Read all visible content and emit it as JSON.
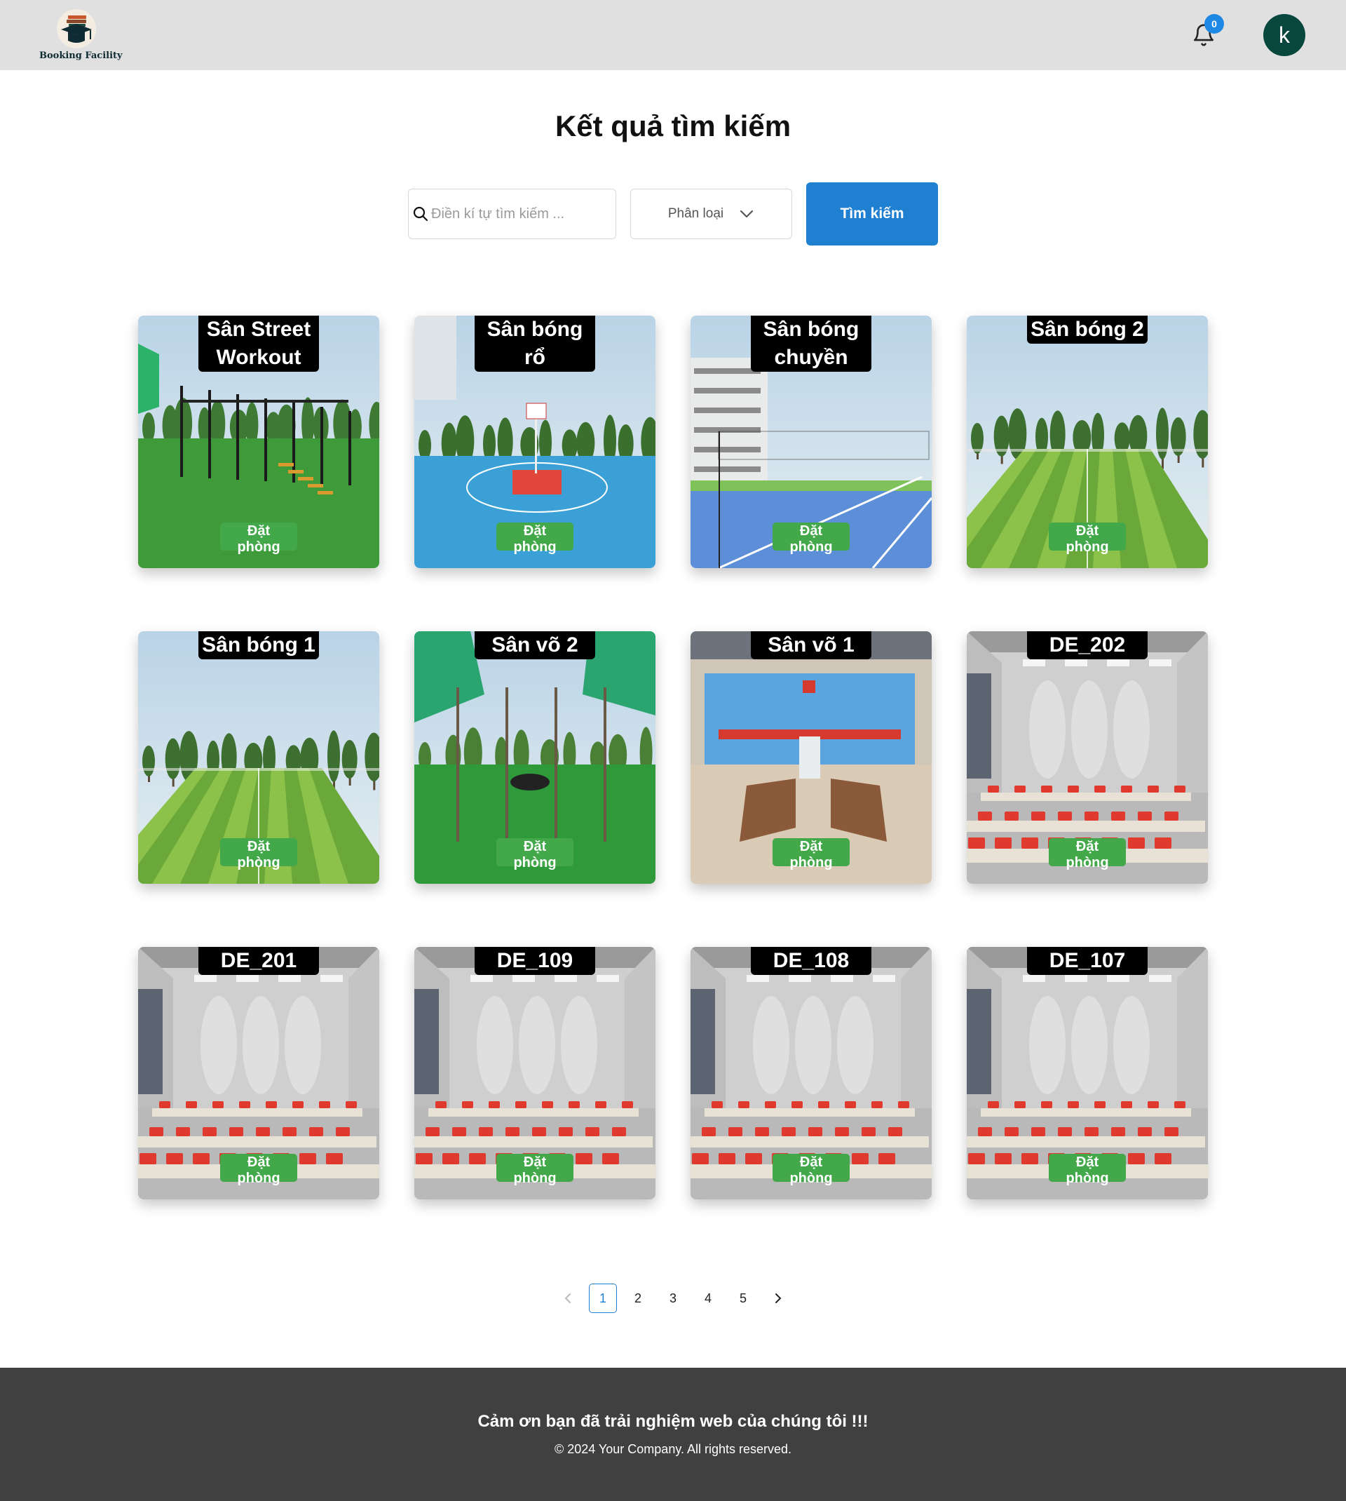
{
  "header": {
    "logo_text": "Booking Facility",
    "notification_count": "0",
    "avatar_initial": "k"
  },
  "main": {
    "title": "Kết quả tìm kiếm",
    "search": {
      "placeholder": "Điền kí tự tìm kiếm ...",
      "value": ""
    },
    "category_select": {
      "label": "Phân loại"
    },
    "search_button": "Tìm kiếm",
    "book_label": "Đặt phòng",
    "facilities": [
      {
        "name": "Sân Street Workout",
        "scene": "workout"
      },
      {
        "name": "Sân bóng rổ",
        "scene": "basketball"
      },
      {
        "name": "Sân bóng chuyền",
        "scene": "volleyball"
      },
      {
        "name": "Sân bóng 2",
        "scene": "football"
      },
      {
        "name": "Sân bóng 1",
        "scene": "football-sky"
      },
      {
        "name": "Sân võ 2",
        "scene": "martial-outdoor"
      },
      {
        "name": "Sân võ 1",
        "scene": "martial-hall"
      },
      {
        "name": "DE_202",
        "scene": "classroom"
      },
      {
        "name": "DE_201",
        "scene": "classroom"
      },
      {
        "name": "DE_109",
        "scene": "classroom"
      },
      {
        "name": "DE_108",
        "scene": "classroom"
      },
      {
        "name": "DE_107",
        "scene": "classroom"
      }
    ]
  },
  "pagination": {
    "prev_icon": "chevron-left-icon",
    "next_icon": "chevron-right-icon",
    "pages": [
      "1",
      "2",
      "3",
      "4",
      "5"
    ],
    "current": "1"
  },
  "footer": {
    "thanks": "Cảm ơn bạn đã trải nghiệm web của chúng tôi !!!",
    "copyright": "© 2024 Your Company. All rights reserved."
  },
  "colors": {
    "header_bg": "#e0e0e0",
    "primary": "#1f7fd1",
    "book_button": "#43a84a",
    "avatar": "#07473d",
    "footer_bg": "#404040"
  }
}
